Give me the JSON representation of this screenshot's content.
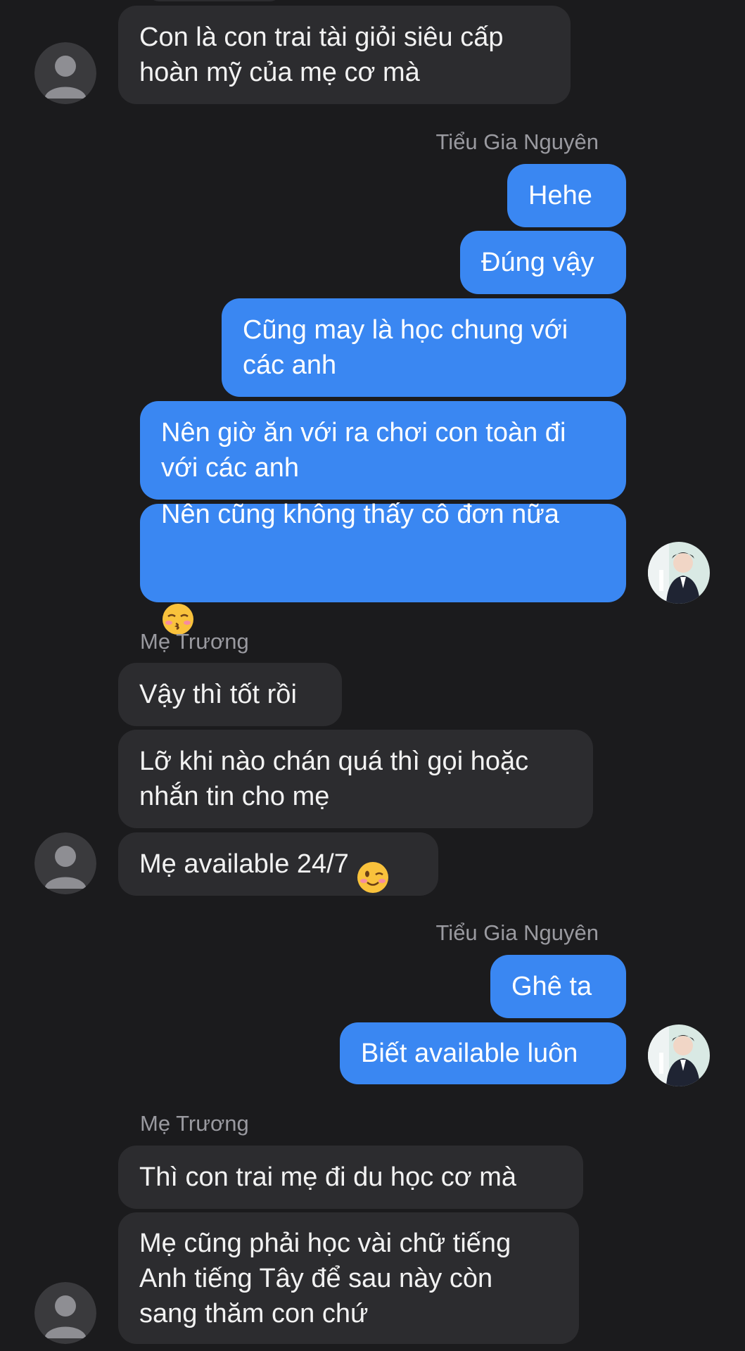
{
  "conversation": {
    "messages": [
      {
        "sender": "Mẹ Trương",
        "direction": "incoming",
        "text": "Con là con trai tài giỏi siêu cấp\nhoàn mỹ của mẹ cơ mà"
      },
      {
        "sender": "Tiểu Gia Nguyên",
        "direction": "outgoing",
        "text": "Hehe"
      },
      {
        "sender": "Tiểu Gia Nguyên",
        "direction": "outgoing",
        "text": "Đúng vậy"
      },
      {
        "sender": "Tiểu Gia Nguyên",
        "direction": "outgoing",
        "text": "Cũng may là học chung với\ncác anh"
      },
      {
        "sender": "Tiểu Gia Nguyên",
        "direction": "outgoing",
        "text": "Nên giờ ăn với ra chơi con toàn đi\nvới các anh"
      },
      {
        "sender": "Tiểu Gia Nguyên",
        "direction": "outgoing",
        "text": "Nên cũng không thấy cô đơn nữa",
        "emoji": "kissing-face-closed-eyes"
      },
      {
        "sender": "Mẹ Trương",
        "direction": "incoming",
        "text": "Vậy thì tốt rồi"
      },
      {
        "sender": "Mẹ Trương",
        "direction": "incoming",
        "text": "Lỡ khi nào chán quá thì gọi hoặc\nnhắn tin cho mẹ"
      },
      {
        "sender": "Mẹ Trương",
        "direction": "incoming",
        "text": "Mẹ available 24/7",
        "emoji": "winking-face"
      },
      {
        "sender": "Tiểu Gia Nguyên",
        "direction": "outgoing",
        "text": "Ghê ta"
      },
      {
        "sender": "Tiểu Gia Nguyên",
        "direction": "outgoing",
        "text": "Biết available luôn"
      },
      {
        "sender": "Mẹ Trương",
        "direction": "incoming",
        "text": "Thì con trai mẹ đi du học cơ mà"
      },
      {
        "sender": "Mẹ Trương",
        "direction": "incoming",
        "text": "Mẹ cũng phải học vài chữ tiếng\nAnh tiếng Tây để sau này còn\nsang thăm con chứ"
      }
    ],
    "sender_labels": {
      "outgoing_1": "Tiểu Gia Nguyên",
      "incoming_1": "Mẹ Trương",
      "outgoing_2": "Tiểu Gia Nguyên",
      "incoming_2": "Mẹ Trương"
    }
  },
  "colors": {
    "background": "#1b1b1d",
    "incoming_bubble": "#2c2c2f",
    "outgoing_bubble": "#3a87f2",
    "sender_label": "#9a9aa0"
  }
}
